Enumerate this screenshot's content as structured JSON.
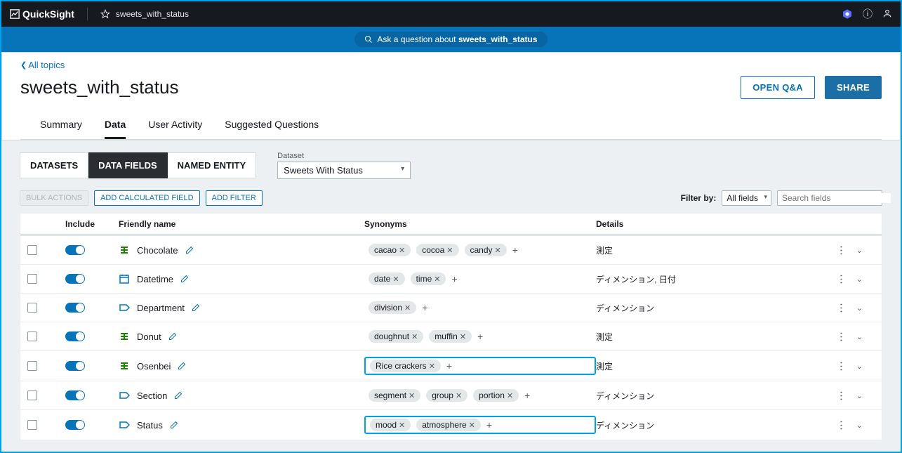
{
  "brand": "QuickSight",
  "file": "sweets_with_status",
  "ask_text": "Ask a question about ",
  "ask_topic": "sweets_with_status",
  "back": "All topics",
  "title": "sweets_with_status",
  "open_qa": "OPEN Q&A",
  "share": "SHARE",
  "tabs": {
    "summary": "Summary",
    "data": "Data",
    "activity": "User Activity",
    "suggested": "Suggested Questions"
  },
  "subtabs": {
    "datasets": "DATASETS",
    "fields": "DATA FIELDS",
    "named": "NAMED ENTITY"
  },
  "dataset_label": "Dataset",
  "dataset_value": "Sweets With Status",
  "bulk": "BULK ACTIONS",
  "add_calc": "ADD CALCULATED FIELD",
  "add_filter": "ADD FILTER",
  "filter_by": "Filter by:",
  "filter_value": "All fields",
  "search_ph": "Search fields",
  "cols": {
    "include": "Include",
    "friendly": "Friendly name",
    "syn": "Synonyms",
    "details": "Details"
  },
  "rows": [
    {
      "icon": "measure",
      "name": "Chocolate",
      "syn": [
        "cacao",
        "cocoa",
        "candy"
      ],
      "details": "測定",
      "hl": false
    },
    {
      "icon": "date",
      "name": "Datetime",
      "syn": [
        "date",
        "time"
      ],
      "details": "ディメンション, 日付",
      "hl": false
    },
    {
      "icon": "dim",
      "name": "Department",
      "syn": [
        "division"
      ],
      "details": "ディメンション",
      "hl": false
    },
    {
      "icon": "measure",
      "name": "Donut",
      "syn": [
        "doughnut",
        "muffin"
      ],
      "details": "測定",
      "hl": false
    },
    {
      "icon": "measure",
      "name": "Osenbei",
      "syn": [
        "Rice crackers"
      ],
      "details": "測定",
      "hl": true
    },
    {
      "icon": "dim",
      "name": "Section",
      "syn": [
        "segment",
        "group",
        "portion"
      ],
      "details": "ディメンション",
      "hl": false
    },
    {
      "icon": "dim",
      "name": "Status",
      "syn": [
        "mood",
        "atmosphere"
      ],
      "details": "ディメンション",
      "hl": true
    }
  ]
}
